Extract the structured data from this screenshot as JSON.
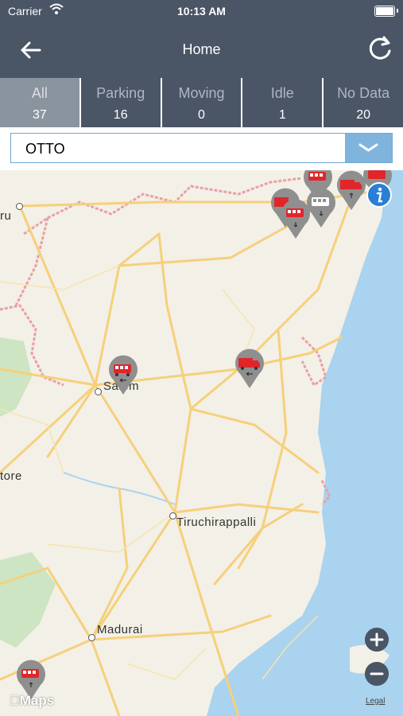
{
  "status_bar": {
    "carrier": "Carrier",
    "time": "10:13 AM"
  },
  "navbar": {
    "title": "Home",
    "back_icon": "arrow-left-icon",
    "refresh_icon": "refresh-icon"
  },
  "tabs": [
    {
      "label": "All",
      "count": "37",
      "active": true
    },
    {
      "label": "Parking",
      "count": "16"
    },
    {
      "label": "Moving",
      "count": "0"
    },
    {
      "label": "Idle",
      "count": "1"
    },
    {
      "label": "No Data",
      "count": "20"
    }
  ],
  "filter": {
    "selected": "OTTO",
    "dropdown_icon": "chevron-down-icon"
  },
  "map": {
    "cities": {
      "salem": "Salem",
      "tiruchirappalli": "Tiruchirappalli",
      "madurai": "Madurai",
      "coimbatore_partial": "tore",
      "bengaluru_partial": "ru"
    },
    "attribution": "Maps",
    "legal": "Legal",
    "colors": {
      "water": "#a9d3ee",
      "road": "#f6d07a",
      "border": "#e8a1a6",
      "land": "#f3f0e7",
      "park": "#cde5c2",
      "pin": "#8f8f8f",
      "vehicle": "#e0262a"
    }
  },
  "zoom": {
    "in_icon": "plus-icon",
    "out_icon": "minus-icon"
  }
}
